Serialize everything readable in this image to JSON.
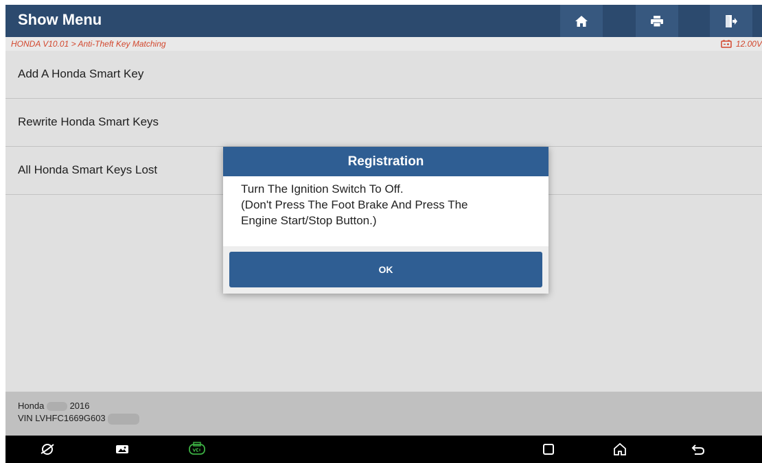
{
  "header": {
    "title": "Show Menu",
    "home_icon": "home-icon",
    "print_icon": "print-icon",
    "exit_icon": "exit-icon"
  },
  "breadcrumb": {
    "path": "HONDA V10.01 > Anti-Theft Key Matching",
    "voltage": "12.00V",
    "battery_icon": "battery-icon"
  },
  "menu": {
    "items": [
      {
        "label": "Add A Honda Smart Key"
      },
      {
        "label": "Rewrite Honda Smart Keys"
      },
      {
        "label": "All Honda Smart Keys Lost"
      }
    ]
  },
  "footer": {
    "vehicle_make": "Honda",
    "vehicle_year": "2016",
    "vin": "VIN LVHFC1669G603"
  },
  "dialog": {
    "title": "Registration",
    "lines": [
      "Turn The Ignition Switch To Off.",
      "(Don't Press The Foot Brake And Press The",
      "Engine Start/Stop Button.)"
    ],
    "ok_label": "OK"
  },
  "navbar": {
    "icons": [
      "browser-icon",
      "gallery-icon",
      "vci-icon",
      "recent-apps-icon",
      "home-nav-icon",
      "back-icon"
    ]
  },
  "colors": {
    "header": "#2c4a6e",
    "dialog_accent": "#2f5e93",
    "breadcrumb_text": "#d2462c",
    "vci_icon": "#3cb043"
  }
}
